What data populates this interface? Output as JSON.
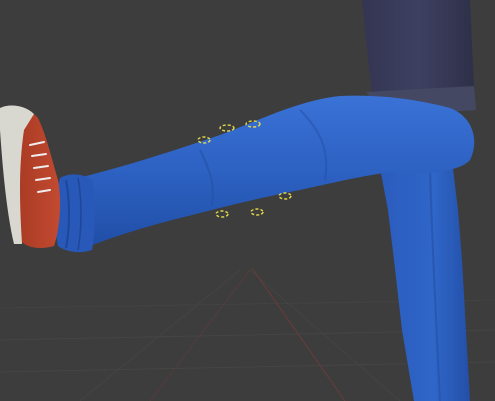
{
  "viewport": {
    "background_color": "#3d3d3d",
    "grid_line_color": "#4a4a4a",
    "axis_x_color": "#7a3a3a",
    "selection_color": "#e2d84a"
  },
  "model": {
    "jeans_color": "#2f63c4",
    "shirt_color": "#3a3b5a",
    "waistband_color": "#454863",
    "shoe_upper_color": "#b8412a",
    "shoe_sole_color": "#d8d8d0",
    "lace_color": "#eeeeee"
  }
}
